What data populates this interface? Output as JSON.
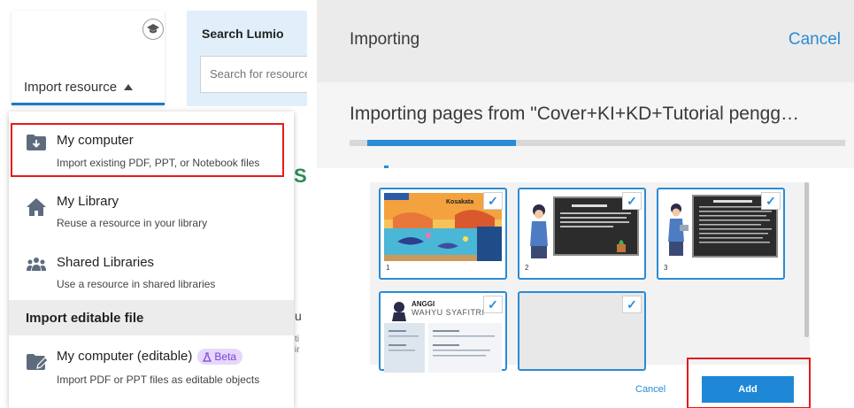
{
  "left_panel": {
    "import_resource_label": "Import resource",
    "search_title": "Search Lumio",
    "search_placeholder": "Search for resources",
    "dropdown": {
      "items": [
        {
          "title": "My computer",
          "desc": "Import existing PDF, PPT, or Notebook files",
          "icon": "folder-download-icon"
        },
        {
          "title": "My Library",
          "desc": "Reuse a resource in your library",
          "icon": "home-icon"
        },
        {
          "title": "Shared Libraries",
          "desc": "Use a resource in shared libraries",
          "icon": "people-icon"
        }
      ],
      "section_title": "Import editable file",
      "editable_item": {
        "title": "My computer (editable)",
        "badge": "Beta",
        "desc": "Import PDF or PPT files as editable objects",
        "icon": "folder-edit-icon"
      }
    },
    "background_fragments": {
      "s": "S",
      "u": "u",
      "ti": "ti\nir"
    }
  },
  "dialog": {
    "title": "Importing",
    "cancel_label": "Cancel",
    "importing_text": "Importing pages from \"Cover+KI+KD+Tutorial pengg…",
    "progress_fraction": 0.3,
    "pages": [
      {
        "number": "1",
        "checked": true
      },
      {
        "number": "2",
        "checked": true
      },
      {
        "number": "3",
        "checked": true
      },
      {
        "number": "",
        "checked": true,
        "slide_title": "ANGGI",
        "slide_subtitle": "WAHYU SYAFITRI"
      },
      {
        "number": "",
        "checked": true
      }
    ],
    "footer_cancel": "Cancel",
    "add_label": "Add"
  },
  "colors": {
    "accent": "#2a8bd6",
    "highlight": "#e41b1b",
    "beta": "#7a3fd9"
  }
}
